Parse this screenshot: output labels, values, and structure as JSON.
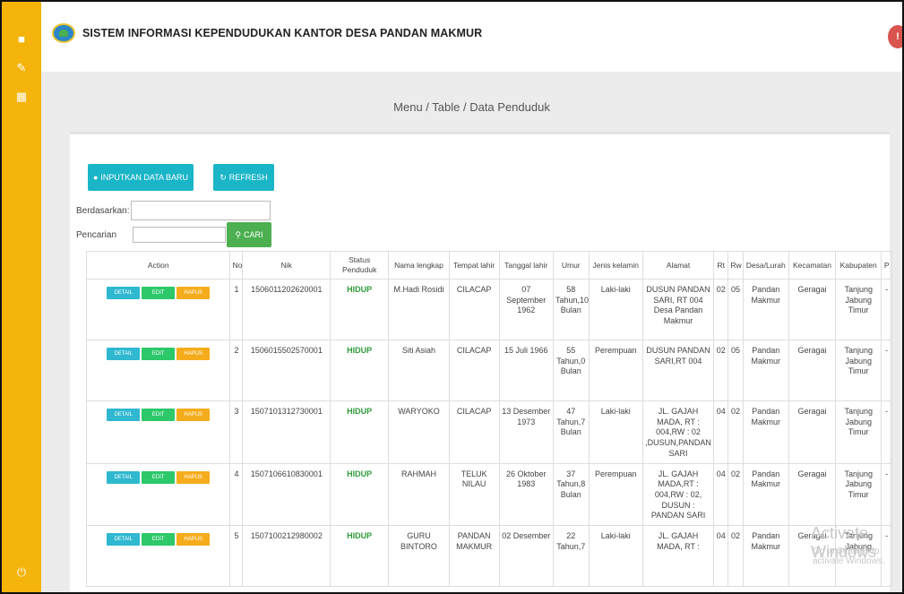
{
  "app_title": "SISTEM INFORMASI KEPENDUDUKAN KANTOR DESA PANDAN MAKMUR",
  "breadcrumb": "Menu / Table / Data Penduduk",
  "buttons": {
    "input_new": "INPUTKAN DATA BARU",
    "refresh": "REFRESH",
    "search": "CARI"
  },
  "filter": {
    "by_label": "Berdasarkan",
    "search_label": "Pencarian",
    "by_value": "",
    "search_value": ""
  },
  "row_actions": {
    "detail": "DETAIL",
    "edit": "EDIT",
    "hapus": "HAPUS"
  },
  "columns": [
    "Action",
    "No",
    "Nik",
    "Status Penduduk",
    "Nama lengkap",
    "Tempat lahir",
    "Tanggal lahir",
    "Umur",
    "Jenis kelamin",
    "Alamat",
    "Rt",
    "Rw",
    "Desa/Lurah",
    "Kecamatan",
    "Kabupaten",
    "P"
  ],
  "rows": [
    {
      "no": "1",
      "nik": "1506011202620001",
      "status": "HIDUP",
      "nama": "M.Hadi Rosidi",
      "tempat": "CILACAP",
      "tanggal": "07 September 1962",
      "umur": "58 Tahun,10 Bulan",
      "jk": "Laki-laki",
      "alamat": "DUSUN PANDAN SARI, RT 004 Desa Pandan Makmur",
      "rt": "02",
      "rw": "05",
      "desa": "Pandan Makmur",
      "kecamatan": "Geragai",
      "kabupaten": "Tanjung Jabung Timur",
      "p": "-"
    },
    {
      "no": "2",
      "nik": "1506015502570001",
      "status": "HIDUP",
      "nama": "Siti Asiah",
      "tempat": "CILACAP",
      "tanggal": "15 Juli 1966",
      "umur": "55 Tahun,0 Bulan",
      "jk": "Perempuan",
      "alamat": "DUSUN PANDAN SARI,RT 004",
      "rt": "02",
      "rw": "05",
      "desa": "Pandan Makmur",
      "kecamatan": "Geragai",
      "kabupaten": "Tanjung Jabung Timur",
      "p": "-"
    },
    {
      "no": "3",
      "nik": "1507101312730001",
      "status": "HIDUP",
      "nama": "WARYOKO",
      "tempat": "CILACAP",
      "tanggal": "13 Desember 1973",
      "umur": "47 Tahun,7 Bulan",
      "jk": "Laki-laki",
      "alamat": "JL. GAJAH MADA, RT : 004,RW : 02 ,DUSUN,PANDAN SARI",
      "rt": "04",
      "rw": "02",
      "desa": "Pandan Makmur",
      "kecamatan": "Geragai",
      "kabupaten": "Tanjung Jabung Timur",
      "p": "-"
    },
    {
      "no": "4",
      "nik": "1507106610830001",
      "status": "HIDUP",
      "nama": "RAHMAH",
      "tempat": "TELUK NILAU",
      "tanggal": "26 Oktober 1983",
      "umur": "37 Tahun,8 Bulan",
      "jk": "Perempuan",
      "alamat": "JL. GAJAH MADA,RT : 004,RW : 02, DUSUN : PANDAN SARI",
      "rt": "04",
      "rw": "02",
      "desa": "Pandan Makmur",
      "kecamatan": "Geragai",
      "kabupaten": "Tanjung Jabung Timur",
      "p": "-"
    },
    {
      "no": "5",
      "nik": "1507100212980002",
      "status": "HIDUP",
      "nama": "GURU BINTORO",
      "tempat": "PANDAN MAKMUR",
      "tanggal": "02 Desember",
      "umur": "22 Tahun,7",
      "jk": "Laki-laki",
      "alamat": "JL. GAJAH MADA, RT :",
      "rt": "04",
      "rw": "02",
      "desa": "Pandan Makmur",
      "kecamatan": "Geragai",
      "kabupaten": "Tanjung Jabung",
      "p": "-"
    }
  ],
  "watermark": {
    "title": "Activate Windows",
    "subtitle": "Go to Settings to activate Windows."
  }
}
